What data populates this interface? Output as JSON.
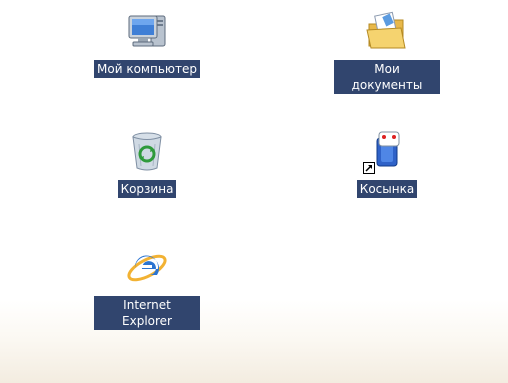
{
  "desktop": {
    "background_color": "#ffffff",
    "label_background_color": "#31456e",
    "label_text_color": "#ffffff",
    "icons": [
      {
        "label": "Мой компьютер",
        "icon": "computer-icon"
      },
      {
        "label": "Мои документы",
        "icon": "folder-documents-icon"
      },
      {
        "label": "Корзина",
        "icon": "recycle-bin-icon"
      },
      {
        "label": "Косынка",
        "icon": "solitaire-icon",
        "shortcut": true
      },
      {
        "label": "Internet Explorer",
        "icon": "internet-explorer-icon"
      }
    ]
  }
}
